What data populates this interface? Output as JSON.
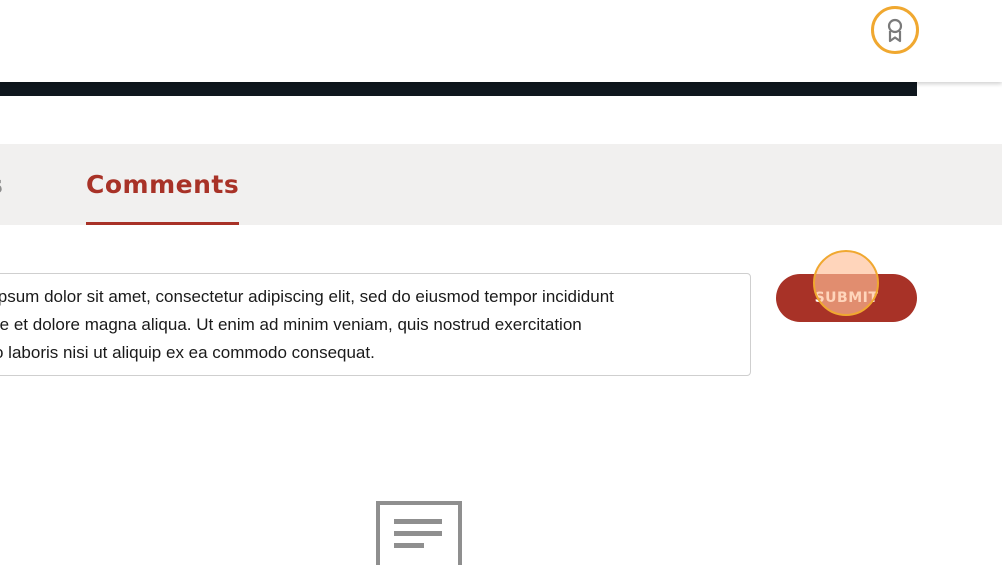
{
  "header": {
    "badge_icon": "award-ribbon-icon",
    "accent_color": "#f0a830"
  },
  "tabs": [
    {
      "label": "s",
      "active": false
    },
    {
      "label": "Comments",
      "active": true
    }
  ],
  "comment": {
    "lines": [
      "ipsum dolor sit amet, consectetur adipiscing elit, sed do eiusmod tempor incididunt",
      "re et dolore magna aliqua. Ut enim ad minim veniam, quis nostrud exercitation",
      "o laboris nisi ut aliquip ex ea commodo consequat."
    ]
  },
  "submit": {
    "label": "SUBMIT",
    "color": "#a83227"
  },
  "empty_state": {
    "icon": "document-text-icon"
  }
}
